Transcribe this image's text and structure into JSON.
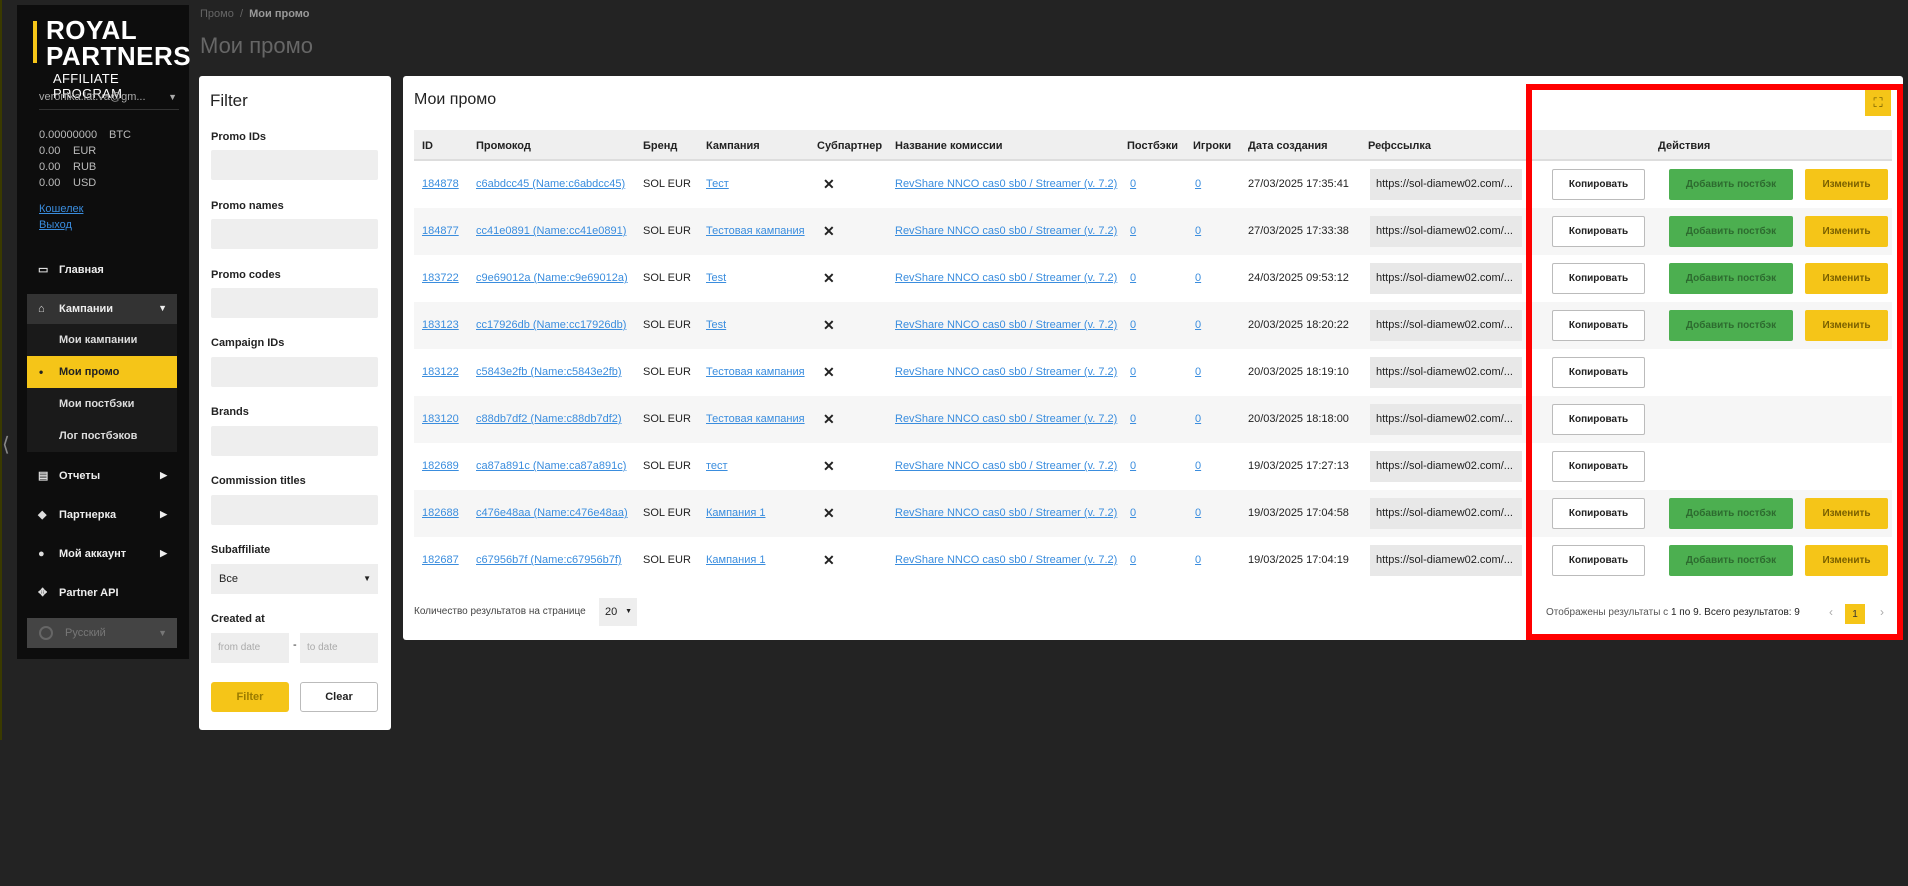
{
  "sidebar": {
    "logo": {
      "line1": "ROYAL",
      "line2": "PARTNERS",
      "line3": "AFFILIATE PROGRAM"
    },
    "user": "veronika.lat.va@gm...",
    "balances": [
      {
        "amount": "0.00000000",
        "currency": "BTC"
      },
      {
        "amount": "0.00",
        "currency": "EUR"
      },
      {
        "amount": "0.00",
        "currency": "RUB"
      },
      {
        "amount": "0.00",
        "currency": "USD"
      }
    ],
    "wallet": "Кошелек",
    "logout": "Выход",
    "nav": {
      "home": "Главная",
      "campaigns": "Кампании",
      "sub": [
        "Мои кампании",
        "Мои промо",
        "Мои постбэки",
        "Лог постбэков"
      ],
      "reports": "Отчеты",
      "partnership": "Партнерка",
      "account": "Мой аккаунт",
      "api": "Partner API"
    },
    "language": "Русский"
  },
  "breadcrumb": {
    "parent": "Промо",
    "sep": "/",
    "current": "Мои промо"
  },
  "page_title": "Мои промо",
  "filter": {
    "title": "Filter",
    "labels": [
      "Promo IDs",
      "Promo names",
      "Promo codes",
      "Campaign IDs",
      "Brands",
      "Commission titles"
    ],
    "subaffiliate_label": "Subaffiliate",
    "subaffiliate_value": "Все",
    "created_label": "Created at",
    "from_placeholder": "from date",
    "to_placeholder": "to date",
    "filter_btn": "Filter",
    "clear_btn": "Clear"
  },
  "table": {
    "title": "Мои промо",
    "headers": {
      "id": "ID",
      "promo": "Промокод",
      "brand": "Бренд",
      "campaign": "Кампания",
      "subpartner": "Субпартнер",
      "commission": "Название комиссии",
      "postbacks": "Постбэки",
      "players": "Игроки",
      "created": "Дата создания",
      "ref": "Рефссылка",
      "actions": "Действия"
    },
    "copy_label": "Копировать",
    "add_label": "Добавить постбэк",
    "edit_label": "Изменить",
    "rows": [
      {
        "id": "184878",
        "promo": "c6abdcc45 (Name:c6abdcc45)",
        "brand": "SOL EUR",
        "campaign": "Тест",
        "commission": "RevShare NNCO cas0 sb0 / Streamer (v. 7.2)",
        "postbacks": "0",
        "players": "0",
        "created": "27/03/2025 17:35:41",
        "ref": "https://sol-diamew02.com/...",
        "x": "✕",
        "actions": true
      },
      {
        "id": "184877",
        "promo": "cc41e0891 (Name:cc41e0891)",
        "brand": "SOL EUR",
        "campaign": "Тестовая кампания",
        "commission": "RevShare NNCO cas0 sb0 / Streamer (v. 7.2)",
        "postbacks": "0",
        "players": "0",
        "created": "27/03/2025 17:33:38",
        "ref": "https://sol-diamew02.com/...",
        "x": "✕",
        "actions": true
      },
      {
        "id": "183722",
        "promo": "c9e69012a (Name:c9e69012a)",
        "brand": "SOL EUR",
        "campaign": "Test",
        "commission": "RevShare NNCO cas0 sb0 / Streamer (v. 7.2)",
        "postbacks": "0",
        "players": "0",
        "created": "24/03/2025 09:53:12",
        "ref": "https://sol-diamew02.com/...",
        "x": "✕",
        "actions": true
      },
      {
        "id": "183123",
        "promo": "cc17926db (Name:cc17926db)",
        "brand": "SOL EUR",
        "campaign": "Test",
        "commission": "RevShare NNCO cas0 sb0 / Streamer (v. 7.2)",
        "postbacks": "0",
        "players": "0",
        "created": "20/03/2025 18:20:22",
        "ref": "https://sol-diamew02.com/...",
        "x": "✕",
        "actions": true
      },
      {
        "id": "183122",
        "promo": "c5843e2fb (Name:c5843e2fb)",
        "brand": "SOL EUR",
        "campaign": "Тестовая кампания",
        "commission": "RevShare NNCO cas0 sb0 / Streamer (v. 7.2)",
        "postbacks": "0",
        "players": "0",
        "created": "20/03/2025 18:19:10",
        "ref": "https://sol-diamew02.com/...",
        "x": "✕",
        "actions": false
      },
      {
        "id": "183120",
        "promo": "c88db7df2 (Name:c88db7df2)",
        "brand": "SOL EUR",
        "campaign": "Тестовая кампания",
        "commission": "RevShare NNCO cas0 sb0 / Streamer (v. 7.2)",
        "postbacks": "0",
        "players": "0",
        "created": "20/03/2025 18:18:00",
        "ref": "https://sol-diamew02.com/...",
        "x": "✕",
        "actions": false
      },
      {
        "id": "182689",
        "promo": "ca87a891c (Name:ca87a891c)",
        "brand": "SOL EUR",
        "campaign": "тест",
        "commission": "RevShare NNCO cas0 sb0 / Streamer (v. 7.2)",
        "postbacks": "0",
        "players": "0",
        "created": "19/03/2025 17:27:13",
        "ref": "https://sol-diamew02.com/...",
        "x": "✕",
        "actions": false
      },
      {
        "id": "182688",
        "promo": "c476e48aa (Name:c476e48aa)",
        "brand": "SOL EUR",
        "campaign": "Кампания 1",
        "commission": "RevShare NNCO cas0 sb0 / Streamer (v. 7.2)",
        "postbacks": "0",
        "players": "0",
        "created": "19/03/2025 17:04:58",
        "ref": "https://sol-diamew02.com/...",
        "x": "✕",
        "actions": true
      },
      {
        "id": "182687",
        "promo": "c67956b7f (Name:c67956b7f)",
        "brand": "SOL EUR",
        "campaign": "Кампания 1",
        "commission": "RevShare NNCO cas0 sb0 / Streamer (v. 7.2)",
        "postbacks": "0",
        "players": "0",
        "created": "19/03/2025 17:04:19",
        "ref": "https://sol-diamew02.com/...",
        "x": "✕",
        "actions": true
      }
    ],
    "per_page_label": "Количество результатов на странице",
    "per_page_value": "20",
    "results_prefix": "Отображены результаты с",
    "results_range": "1 по 9. Всего результатов: 9",
    "current_page": "1"
  },
  "colors": {
    "accent": "#f5c518",
    "add_button": "#4caf50",
    "link": "#3a8dde",
    "highlight_box": "#ff0000"
  }
}
